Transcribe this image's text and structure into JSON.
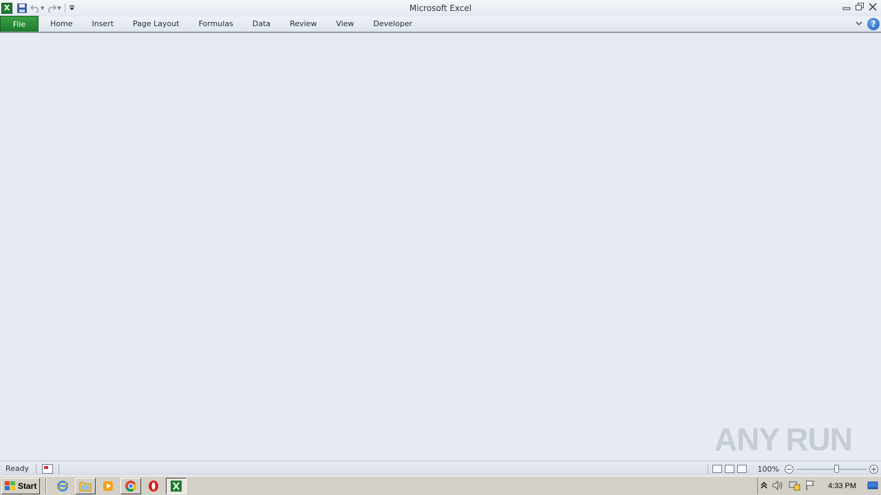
{
  "window": {
    "title": "Microsoft Excel",
    "app_icon_letter": "X"
  },
  "ribbon": {
    "tabs": [
      {
        "label": "File"
      },
      {
        "label": "Home"
      },
      {
        "label": "Insert"
      },
      {
        "label": "Page Layout"
      },
      {
        "label": "Formulas"
      },
      {
        "label": "Data"
      },
      {
        "label": "Review"
      },
      {
        "label": "View"
      },
      {
        "label": "Developer"
      }
    ],
    "help_label": "?"
  },
  "status": {
    "ready": "Ready",
    "zoom": "100%",
    "zoom_out": "−",
    "zoom_in": "+"
  },
  "watermark": {
    "left": "ANY",
    "right": "RUN"
  },
  "taskbar": {
    "start_label": "Start",
    "clock": "4:33 PM"
  },
  "colors": {
    "file_tab": "#2f8f3c",
    "workspace": "#e6eaf2",
    "taskbar": "#d4d0c8"
  }
}
